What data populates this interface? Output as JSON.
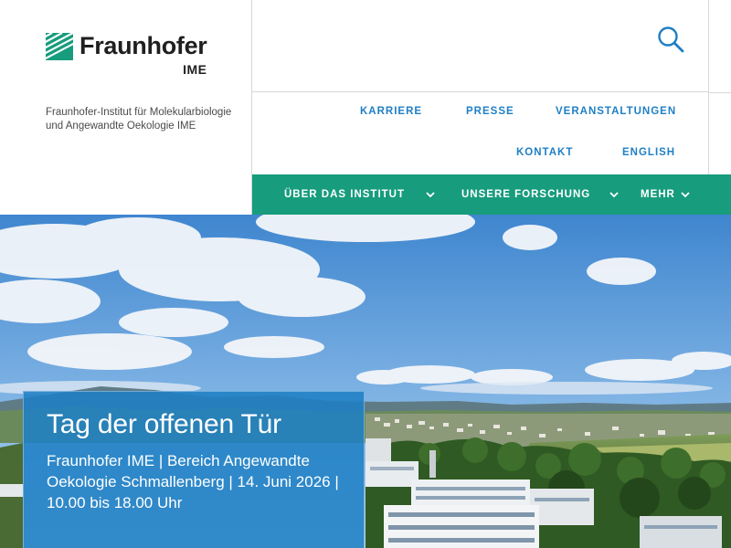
{
  "header": {
    "logo": {
      "name": "Fraunhofer",
      "sub": "IME",
      "icon": "fraunhofer-logo-icon",
      "color": "#179c7d"
    },
    "institute_name": "Fraunhofer-Institut für Molekularbio­logie und Angewandte Oekologie IME",
    "search_icon": "search-icon",
    "meta_nav": [
      "KARRIERE",
      "PRESSE",
      "VERANSTALTUNGEN",
      "KONTAKT",
      "ENGLISH"
    ],
    "main_nav": [
      {
        "label": "ÜBER DAS INSTITUT",
        "icon": "chevron-down-icon"
      },
      {
        "label": "UNSERE FORSCHUNG",
        "icon": "chevron-down-icon"
      },
      {
        "label": "MEHR",
        "icon": "chevron-down-icon"
      }
    ]
  },
  "hero": {
    "teaser_title": "Tag der offenen Tür",
    "teaser_text": "Fraunhofer IME | Bereich Angewandte Oekologie Schmallenberg | 14. Juni 2026 | 10.00 bis 18.00 Uhr"
  },
  "colors": {
    "brand_green": "#179c7d",
    "link_blue": "#1f7fc4",
    "teaser_blue": "#1f7fc4",
    "divider": "#d7d7d7"
  }
}
